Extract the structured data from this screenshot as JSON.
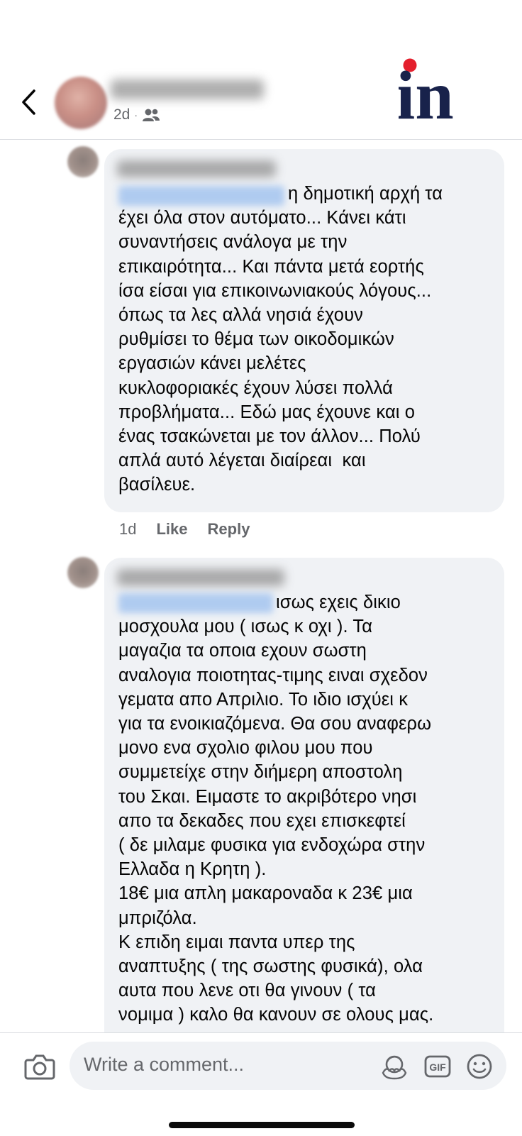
{
  "post": {
    "time": "2d",
    "separator": "·",
    "audience_icon": "friends-icon"
  },
  "brand": {
    "logo_text": "in",
    "accent": "#e41f2d",
    "navy": "#18224b"
  },
  "comments": [
    {
      "text": "η δημοτική αρχή τα\nέχει όλα στον αυτόματο... Κάνει κάτι\nσυναντήσεις ανάλογα με την\nεπικαιρότητα... Και πάντα μετά εορτής\nίσα είσαι για επικοινωνιακούς λόγους...\nόπως τα λες αλλά νησιά έχουν\nρυθμίσει το θέμα των οικοδομικών\nεργασιών κάνει μελέτες\nκυκλοφοριακές έχουν λύσει πολλά\nπροβλήματα... Εδώ μας έχουνε και ο\nένας τσακώνεται με τον άλλον... Πολύ\nαπλά αυτό λέγεται διαίρεαι  και\nβασίλευε.",
      "time": "1d",
      "like_label": "Like",
      "reply_label": "Reply"
    },
    {
      "text": "ισως εχεις δικιο\nμοσχουλα μου ( ισως κ οχι ). Τα\nμαγαζια τα οποια εχουν σωστη\nαναλογια ποιοτητας-τιμης ειναι σχεδον\nγεματα απο Απριλιο. Το ιδιο ισχύει κ\nγια τα ενοικιαζόμενα. Θα σου αναφερω\nμονο ενα σχολιο φιλου μου που\nσυμμετείχε στην διήμερη αποστολη\nτου Σκαι. Ειμαστε το ακριβότερο νησι\nαπο τα δεκαδες που εχει επισκεφτεί\n( δε μιλαμε φυσικα για ενδοχώρα στην\nΕλλαδα η Κρητη ).\n18€ μια απλη μακαροναδα κ 23€ μια\nμπριζόλα.\nΚ επιδη ειμαι παντα υπερ της\nαναπτυξης ( της σωστης φυσικά), ολα\nαυτα που λενε οτι θα γινουν ( τα\nνομιμα ) καλο θα κανουν σε ολους μας."
    }
  ],
  "composer": {
    "placeholder": "Write a comment...",
    "gif_label": "GIF",
    "icons": [
      "camera-icon",
      "avatar-sticker-icon",
      "gif-icon",
      "emoji-icon"
    ]
  }
}
